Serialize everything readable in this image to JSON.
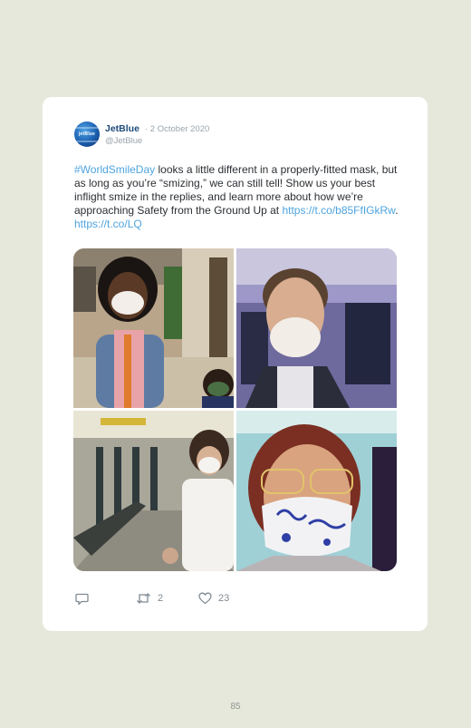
{
  "tweet": {
    "author_name": "JetBlue",
    "date": "· 2 October 2020",
    "handle": "@JetBlue",
    "avatar_text": "jetBlue",
    "text": {
      "hashtag": "#WorldSmileDay",
      "body": " looks a little different in a properly-fitted mask, but as long as you’re “smizing,” we can still tell! Show us your best inflight smize in the replies, and learn more about how we’re approaching Safety from the Ground Up at ",
      "link1": "https://t.co/b85FfIGkRw",
      "sep": ". ",
      "link2": "https://t.co/LQ"
    },
    "photos": [
      {
        "name": "girl-in-mask-photo"
      },
      {
        "name": "man-in-n95-mask-photo"
      },
      {
        "name": "woman-in-terminal-photo"
      },
      {
        "name": "woman-in-patterned-mask-photo"
      }
    ],
    "actions": {
      "reply_icon": "reply-icon",
      "retweet_icon": "retweet-icon",
      "retweet_count": "2",
      "like_icon": "heart-icon",
      "like_count": "23"
    }
  },
  "page_number": "85",
  "colors": {
    "background": "#e7e8dc",
    "card": "#ffffff",
    "author": "#1e4a7a",
    "link": "#4ea4df",
    "muted": "#9aa4ac"
  }
}
